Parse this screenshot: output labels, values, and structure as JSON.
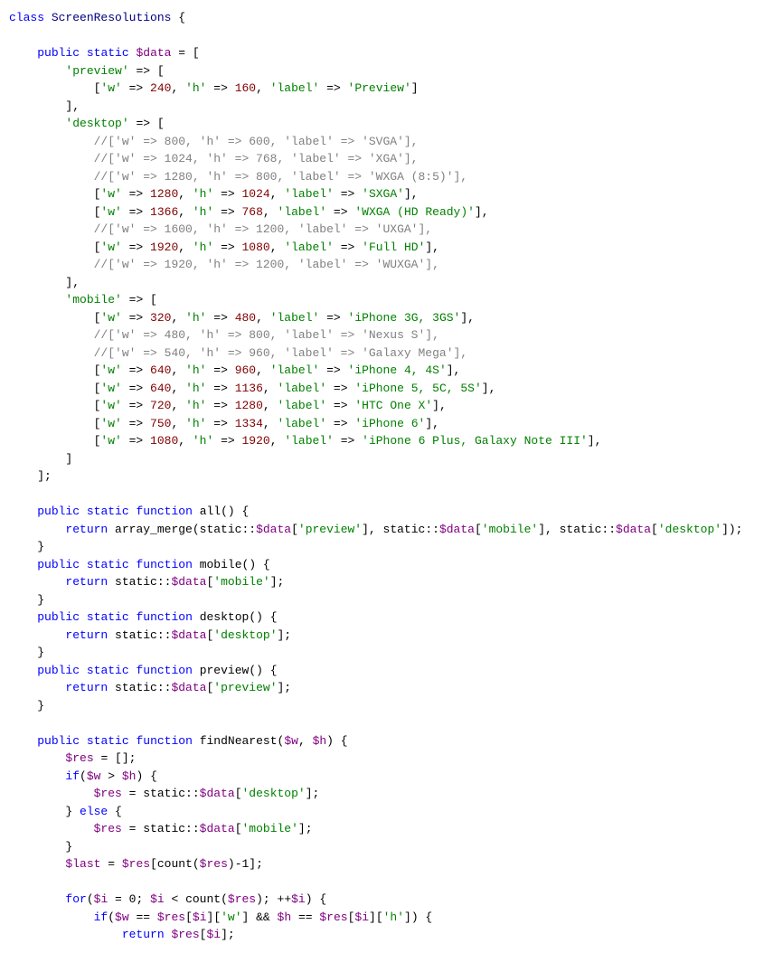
{
  "code": {
    "lines": [
      {
        "type": "plain",
        "content": "<span class='kw'>class</span> <span class='class-name'>ScreenResolutions</span> {"
      },
      {
        "type": "plain",
        "content": ""
      },
      {
        "type": "plain",
        "content": "    <span class='kw'>public</span> <span class='kw'>static</span> <span class='var'>$data</span> = ["
      },
      {
        "type": "plain",
        "content": "        <span class='str'>'preview'</span> => ["
      },
      {
        "type": "plain",
        "content": "            [<span class='str'>'w'</span> => <span class='num'>240</span>, <span class='str'>'h'</span> => <span class='num'>160</span>, <span class='str'>'label'</span> => <span class='str'>'Preview'</span>]"
      },
      {
        "type": "plain",
        "content": "        ],"
      },
      {
        "type": "plain",
        "content": "        <span class='str'>'desktop'</span> => ["
      },
      {
        "type": "plain",
        "content": "            <span class='cm'>//['w' => 800, 'h' => 600, 'label' => 'SVGA'],</span>"
      },
      {
        "type": "plain",
        "content": "            <span class='cm'>//['w' => 1024, 'h' => 768, 'label' => 'XGA'],</span>"
      },
      {
        "type": "plain",
        "content": "            <span class='cm'>//['w' => 1280, 'h' => 800, 'label' => 'WXGA (8:5)'],</span>"
      },
      {
        "type": "plain",
        "content": "            [<span class='str'>'w'</span> => <span class='num'>1280</span>, <span class='str'>'h'</span> => <span class='num'>1024</span>, <span class='str'>'label'</span> => <span class='str'>'SXGA'</span>],"
      },
      {
        "type": "plain",
        "content": "            [<span class='str'>'w'</span> => <span class='num'>1366</span>, <span class='str'>'h'</span> => <span class='num'>768</span>, <span class='str'>'label'</span> => <span class='str'>'WXGA (HD Ready)'</span>],"
      },
      {
        "type": "plain",
        "content": "            <span class='cm'>//['w' => 1600, 'h' => 1200, 'label' => 'UXGA'],</span>"
      },
      {
        "type": "plain",
        "content": "            [<span class='str'>'w'</span> => <span class='num'>1920</span>, <span class='str'>'h'</span> => <span class='num'>1080</span>, <span class='str'>'label'</span> => <span class='str'>'Full HD'</span>],"
      },
      {
        "type": "plain",
        "content": "            <span class='cm'>//['w' => 1920, 'h' => 1200, 'label' => 'WUXGA'],</span>"
      },
      {
        "type": "plain",
        "content": "        ],"
      },
      {
        "type": "plain",
        "content": "        <span class='str'>'mobile'</span> => ["
      },
      {
        "type": "plain",
        "content": "            [<span class='str'>'w'</span> => <span class='num'>320</span>, <span class='str'>'h'</span> => <span class='num'>480</span>, <span class='str'>'label'</span> => <span class='str'>'iPhone 3G, 3GS'</span>],"
      },
      {
        "type": "plain",
        "content": "            <span class='cm'>//['w' => 480, 'h' => 800, 'label' => 'Nexus S'],</span>"
      },
      {
        "type": "plain",
        "content": "            <span class='cm'>//['w' => 540, 'h' => 960, 'label' => 'Galaxy Mega'],</span>"
      },
      {
        "type": "plain",
        "content": "            [<span class='str'>'w'</span> => <span class='num'>640</span>, <span class='str'>'h'</span> => <span class='num'>960</span>, <span class='str'>'label'</span> => <span class='str'>'iPhone 4, 4S'</span>],"
      },
      {
        "type": "plain",
        "content": "            [<span class='str'>'w'</span> => <span class='num'>640</span>, <span class='str'>'h'</span> => <span class='num'>1136</span>, <span class='str'>'label'</span> => <span class='str'>'iPhone 5, 5C, 5S'</span>],"
      },
      {
        "type": "plain",
        "content": "            [<span class='str'>'w'</span> => <span class='num'>720</span>, <span class='str'>'h'</span> => <span class='num'>1280</span>, <span class='str'>'label'</span> => <span class='str'>'HTC One X'</span>],"
      },
      {
        "type": "plain",
        "content": "            [<span class='str'>'w'</span> => <span class='num'>750</span>, <span class='str'>'h'</span> => <span class='num'>1334</span>, <span class='str'>'label'</span> => <span class='str'>'iPhone 6'</span>],"
      },
      {
        "type": "plain",
        "content": "            [<span class='str'>'w'</span> => <span class='num'>1080</span>, <span class='str'>'h'</span> => <span class='num'>1920</span>, <span class='str'>'label'</span> => <span class='str'>'iPhone 6 Plus, Galaxy Note III'</span>],"
      },
      {
        "type": "plain",
        "content": "        ]"
      },
      {
        "type": "plain",
        "content": "    ];"
      },
      {
        "type": "plain",
        "content": ""
      },
      {
        "type": "plain",
        "content": "    <span class='kw'>public</span> <span class='kw'>static</span> <span class='kw'>function</span> <span class='fn'>all</span>() {"
      },
      {
        "type": "plain",
        "content": "        <span class='kw'>return</span> array_merge(static::<span class='var'>$data</span>[<span class='str'>'preview'</span>], static::<span class='var'>$data</span>[<span class='str'>'mobile'</span>], static::<span class='var'>$data</span>[<span class='str'>'desktop'</span>]);"
      },
      {
        "type": "plain",
        "content": "    }"
      },
      {
        "type": "plain",
        "content": "    <span class='kw'>public</span> <span class='kw'>static</span> <span class='kw'>function</span> <span class='fn'>mobile</span>() {"
      },
      {
        "type": "plain",
        "content": "        <span class='kw'>return</span> static::<span class='var'>$data</span>[<span class='str'>'mobile'</span>];"
      },
      {
        "type": "plain",
        "content": "    }"
      },
      {
        "type": "plain",
        "content": "    <span class='kw'>public</span> <span class='kw'>static</span> <span class='kw'>function</span> <span class='fn'>desktop</span>() {"
      },
      {
        "type": "plain",
        "content": "        <span class='kw'>return</span> static::<span class='var'>$data</span>[<span class='str'>'desktop'</span>];"
      },
      {
        "type": "plain",
        "content": "    }"
      },
      {
        "type": "plain",
        "content": "    <span class='kw'>public</span> <span class='kw'>static</span> <span class='kw'>function</span> <span class='fn'>preview</span>() {"
      },
      {
        "type": "plain",
        "content": "        <span class='kw'>return</span> static::<span class='var'>$data</span>[<span class='str'>'preview'</span>];"
      },
      {
        "type": "plain",
        "content": "    }"
      },
      {
        "type": "plain",
        "content": ""
      },
      {
        "type": "plain",
        "content": "    <span class='kw'>public</span> <span class='kw'>static</span> <span class='kw'>function</span> <span class='fn'>findNearest</span>(<span class='var'>$w</span>, <span class='var'>$h</span>) {"
      },
      {
        "type": "plain",
        "content": "        <span class='var'>$res</span> = [];"
      },
      {
        "type": "plain",
        "content": "        <span class='kw'>if</span>(<span class='var'>$w</span> > <span class='var'>$h</span>) {"
      },
      {
        "type": "plain",
        "content": "            <span class='var'>$res</span> = static::<span class='var'>$data</span>[<span class='str'>'desktop'</span>];"
      },
      {
        "type": "plain",
        "content": "        } <span class='kw'>else</span> {"
      },
      {
        "type": "plain",
        "content": "            <span class='var'>$res</span> = static::<span class='var'>$data</span>[<span class='str'>'mobile'</span>];"
      },
      {
        "type": "plain",
        "content": "        }"
      },
      {
        "type": "plain",
        "content": "        <span class='var'>$last</span> = <span class='var'>$res</span>[count(<span class='var'>$res</span>)-1];"
      },
      {
        "type": "plain",
        "content": ""
      },
      {
        "type": "plain",
        "content": "        <span class='kw'>for</span>(<span class='var'>$i</span> = 0; <span class='var'>$i</span> < count(<span class='var'>$res</span>); ++<span class='var'>$i</span>) {"
      },
      {
        "type": "plain",
        "content": "            <span class='kw'>if</span>(<span class='var'>$w</span> == <span class='var'>$res</span>[<span class='var'>$i</span>][<span class='str'>'w'</span>] &amp;&amp; <span class='var'>$h</span> == <span class='var'>$res</span>[<span class='var'>$i</span>][<span class='str'>'h'</span>]) {"
      },
      {
        "type": "plain",
        "content": "                <span class='kw'>return</span> <span class='var'>$res</span>[<span class='var'>$i</span>];"
      }
    ]
  }
}
